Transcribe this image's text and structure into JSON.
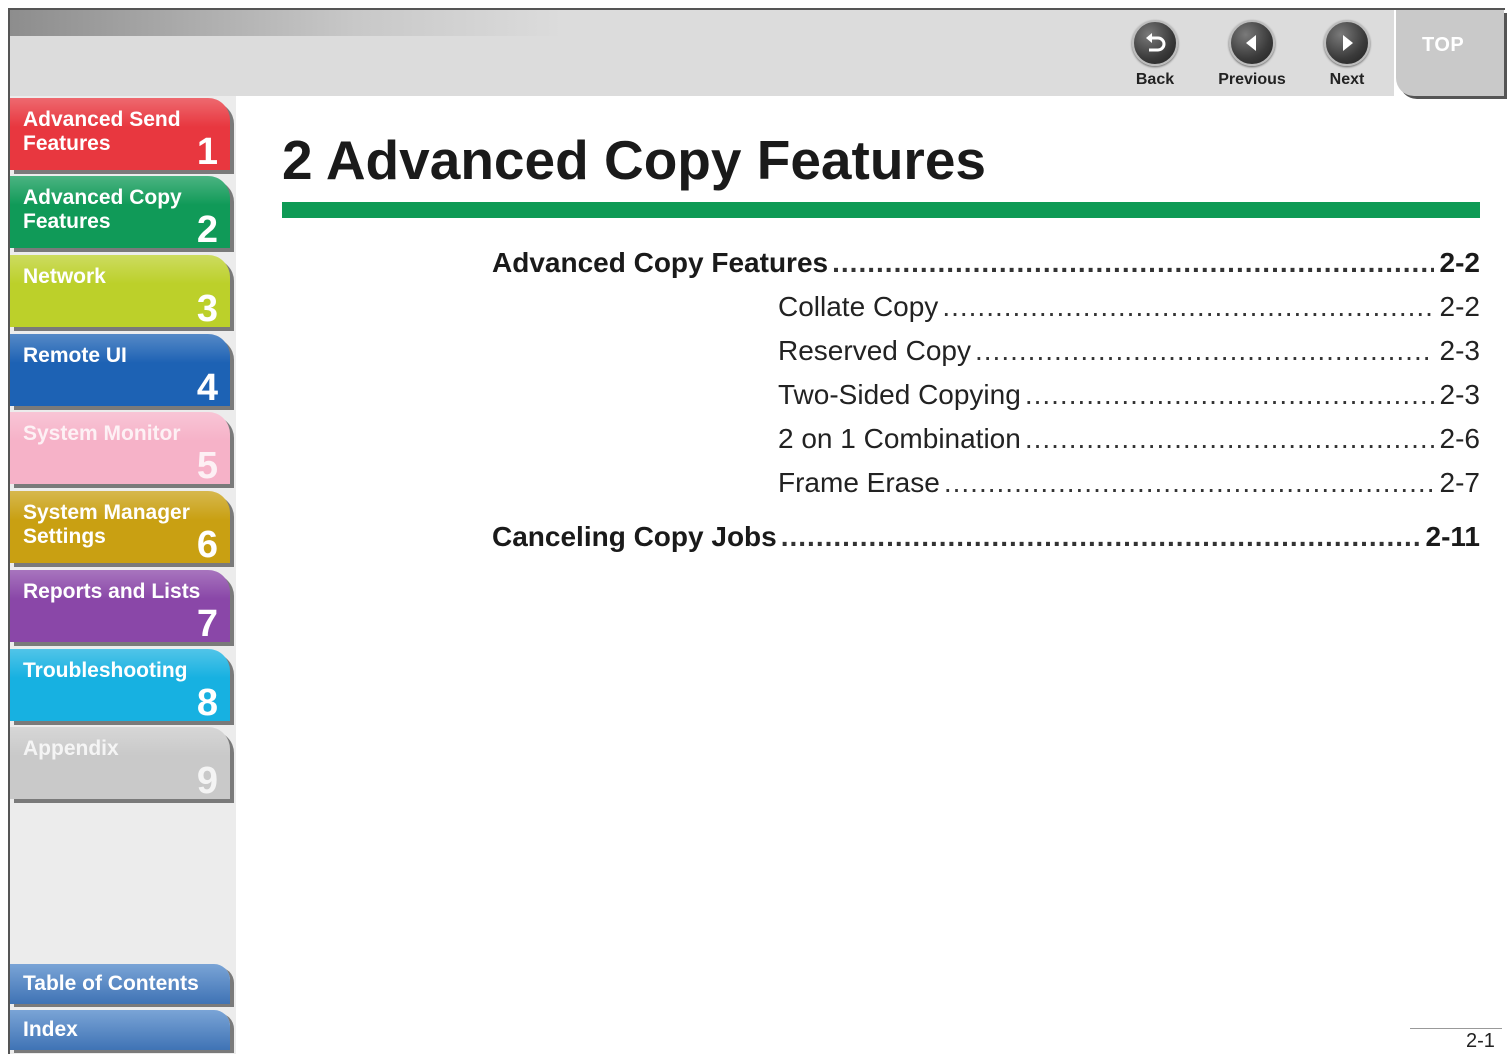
{
  "nav": {
    "back": "Back",
    "previous": "Previous",
    "next": "Next",
    "top": "TOP"
  },
  "sidebar": {
    "chapters": [
      {
        "label": "Advanced Send Features",
        "number": "1",
        "color": "#e8373f"
      },
      {
        "label": "Advanced Copy Features",
        "number": "2",
        "color": "#109a58"
      },
      {
        "label": "Network",
        "number": "3",
        "color": "#bcd02a"
      },
      {
        "label": "Remote UI",
        "number": "4",
        "color": "#1d62b4"
      },
      {
        "label": "System Monitor",
        "number": "5",
        "color": "#f6b2c8"
      },
      {
        "label": "System Manager Settings",
        "number": "6",
        "color": "#c9a012"
      },
      {
        "label": "Reports and Lists",
        "number": "7",
        "color": "#8a47a8"
      },
      {
        "label": "Troubleshooting",
        "number": "8",
        "color": "#17b1e1"
      },
      {
        "label": "Appendix",
        "number": "9",
        "color": "#c9c9c9"
      }
    ],
    "table_of_contents": "Table of Contents",
    "index": "Index"
  },
  "main": {
    "title": "2 Advanced Copy Features",
    "toc": [
      {
        "label": "Advanced Copy Features",
        "page": "2-2",
        "level": 1
      },
      {
        "label": "Collate Copy",
        "page": "2-2",
        "level": 2
      },
      {
        "label": "Reserved Copy",
        "page": "2-3",
        "level": 2
      },
      {
        "label": "Two-Sided Copying",
        "page": "2-3",
        "level": 2
      },
      {
        "label": "2 on 1 Combination",
        "page": "2-6",
        "level": 2
      },
      {
        "label": "Frame Erase",
        "page": "2-7",
        "level": 2
      },
      {
        "label": "Canceling Copy Jobs",
        "page": "2-11",
        "level": 1
      }
    ]
  },
  "footer": {
    "page_number": "2-1"
  },
  "icons": {
    "back": "back-arrow-icon",
    "previous": "previous-arrow-icon",
    "next": "next-arrow-icon"
  }
}
